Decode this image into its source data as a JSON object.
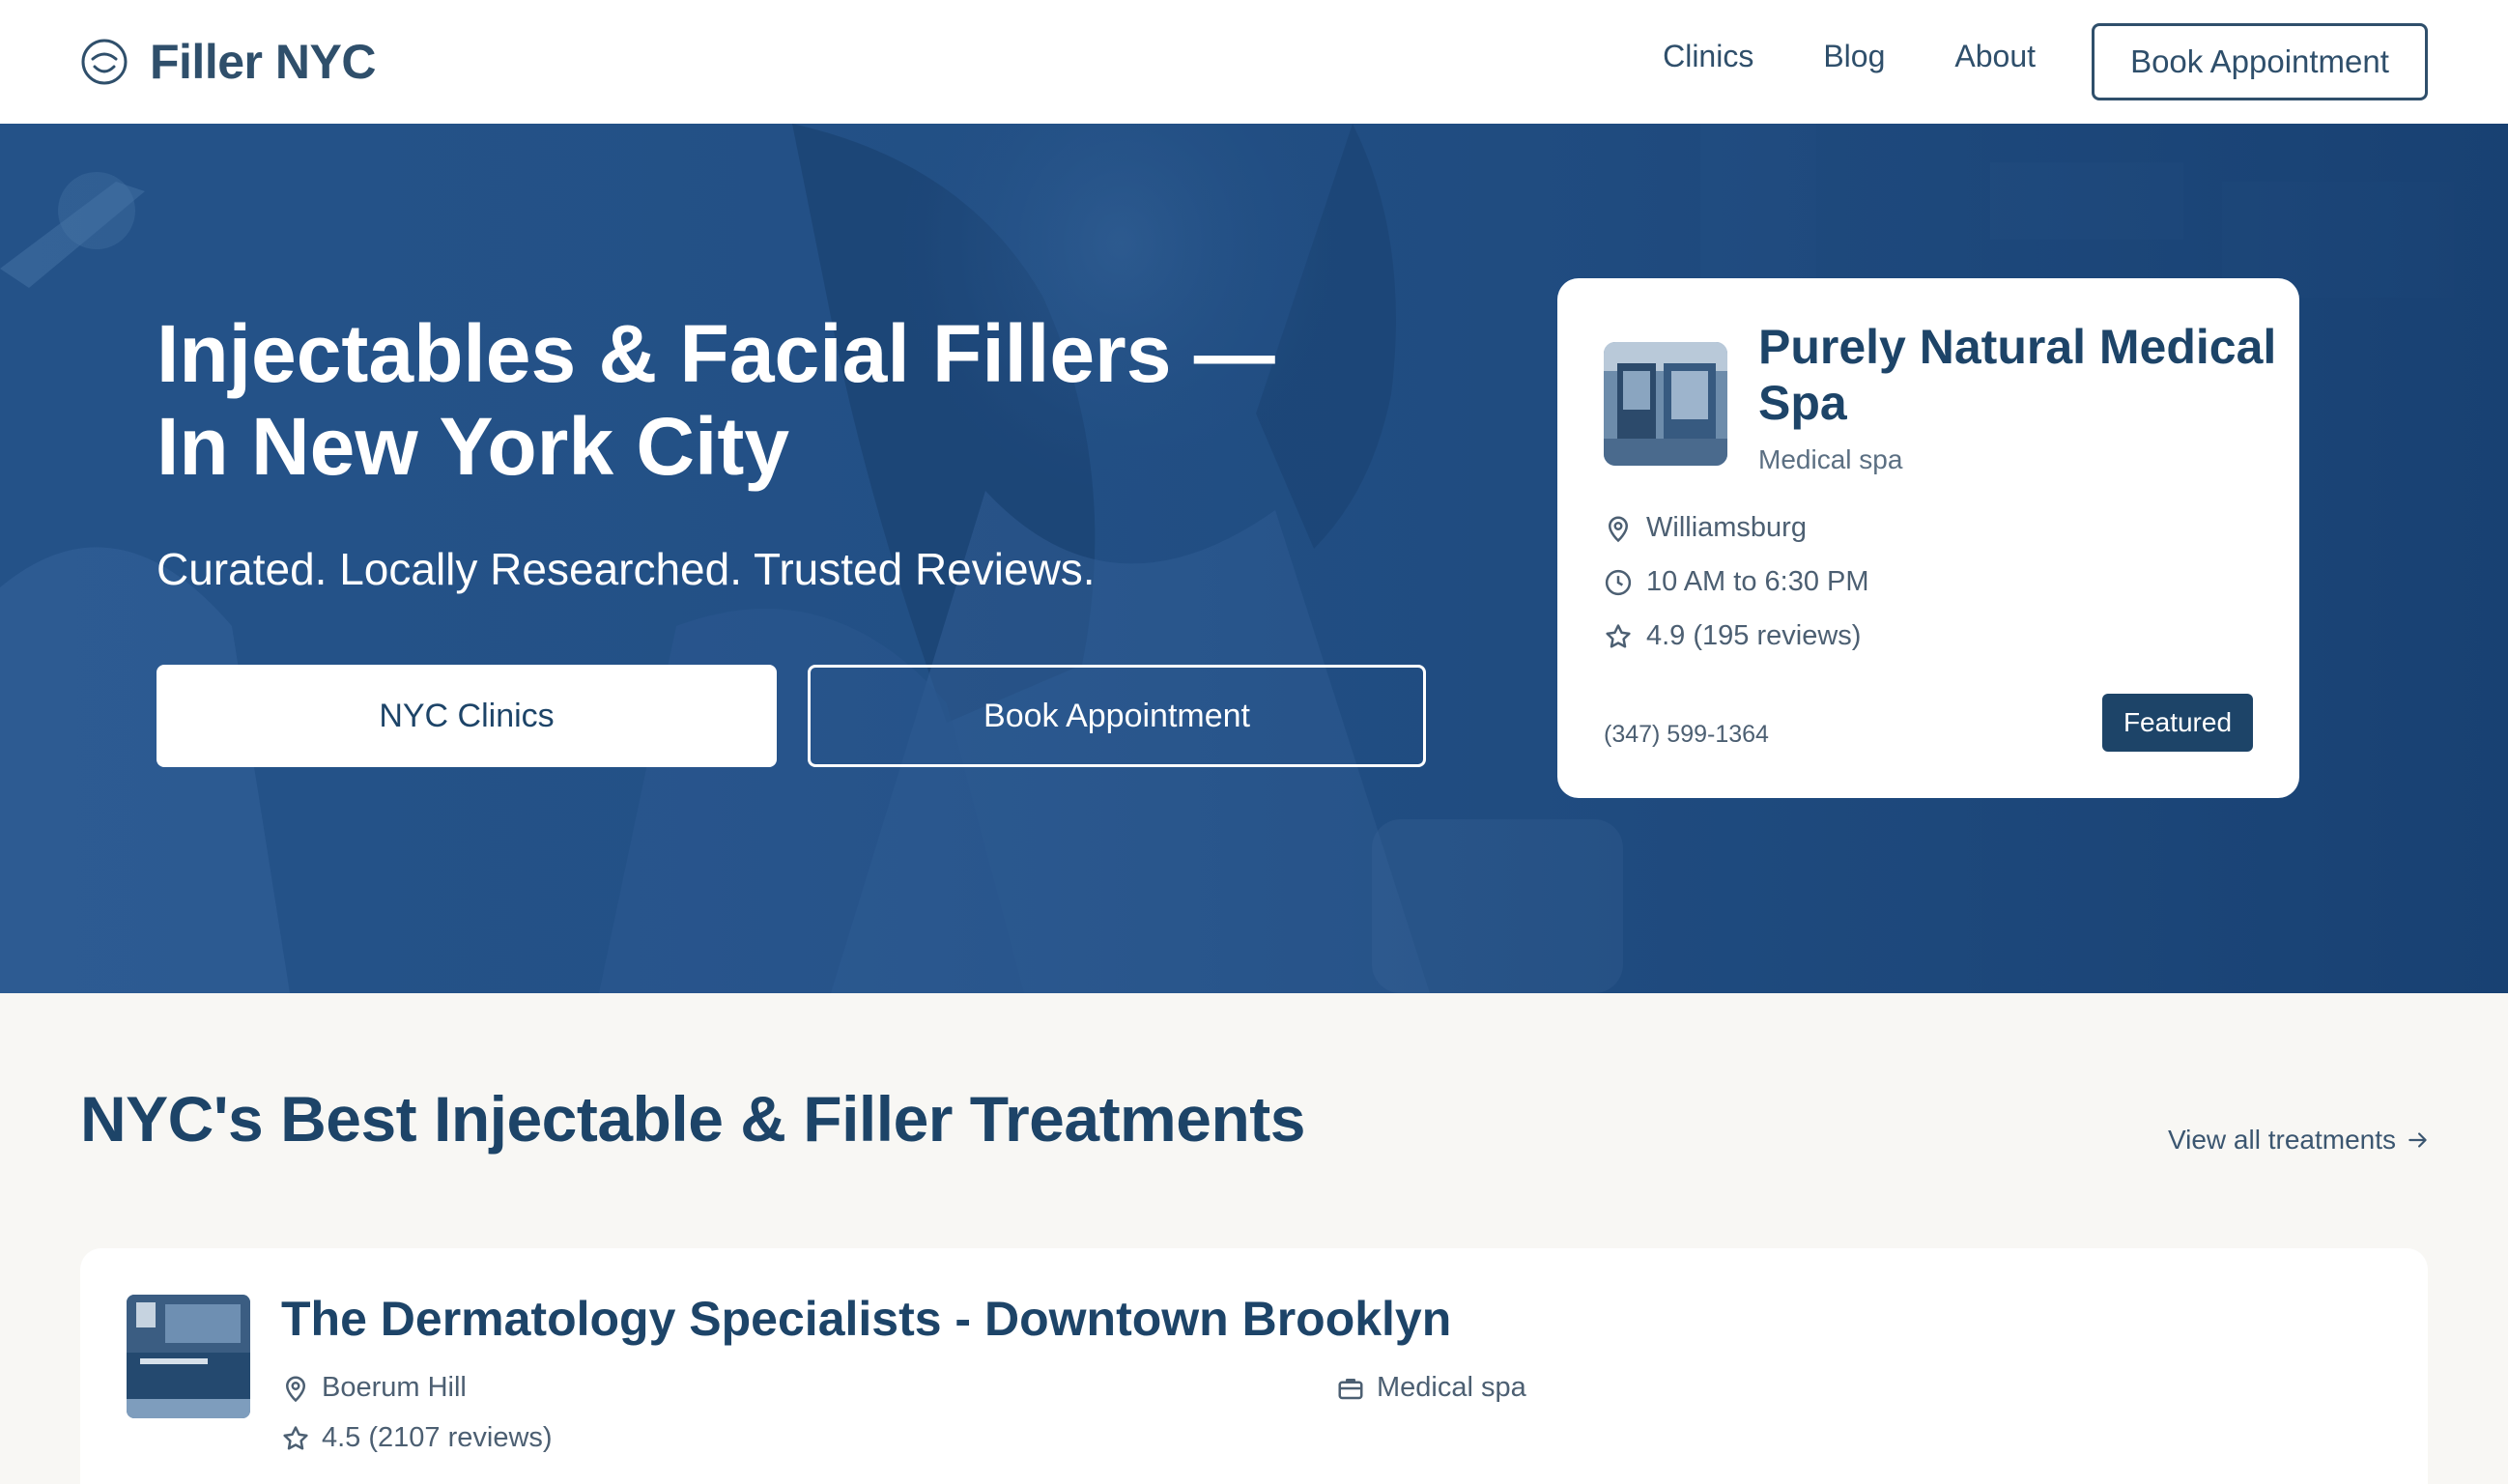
{
  "header": {
    "brand": "Filler NYC",
    "brand_icon": "face-circle-icon",
    "nav": [
      "Clinics",
      "Blog",
      "About"
    ],
    "cta": "Book Appointment"
  },
  "hero": {
    "title_line1": "Injectables & Facial Fillers —",
    "title_line2": "In New York City",
    "subtitle": "Curated. Locally Researched. Trusted Reviews.",
    "primary_button": "NYC Clinics",
    "secondary_button": "Book Appointment",
    "overlay_color": "#245288"
  },
  "featured": {
    "name": "Purely Natural Medical Spa",
    "type": "Medical spa",
    "location": "Williamsburg",
    "hours": "10 AM to 6:30 PM",
    "rating": "4.9 (195 reviews)",
    "phone": "(347) 599-1364",
    "badge": "Featured",
    "icons": [
      "map-pin-icon",
      "clock-icon",
      "star-icon"
    ]
  },
  "section": {
    "title": "NYC's Best Injectable & Filler Treatments",
    "view_all": "View all treatments",
    "view_all_icon": "arrow-right-icon"
  },
  "clinics": [
    {
      "name": "The Dermatology Specialists - Downtown Brooklyn",
      "neighborhood": "Boerum Hill",
      "type": "Medical spa",
      "rating": "4.5 (2107 reviews)",
      "icons": [
        "map-pin-icon",
        "briefcase-icon",
        "star-icon"
      ]
    }
  ],
  "colors": {
    "navy": "#1d4468",
    "slate": "#2f4f6b",
    "hero_blue": "#245288",
    "page_bg": "#f8f7f4"
  }
}
